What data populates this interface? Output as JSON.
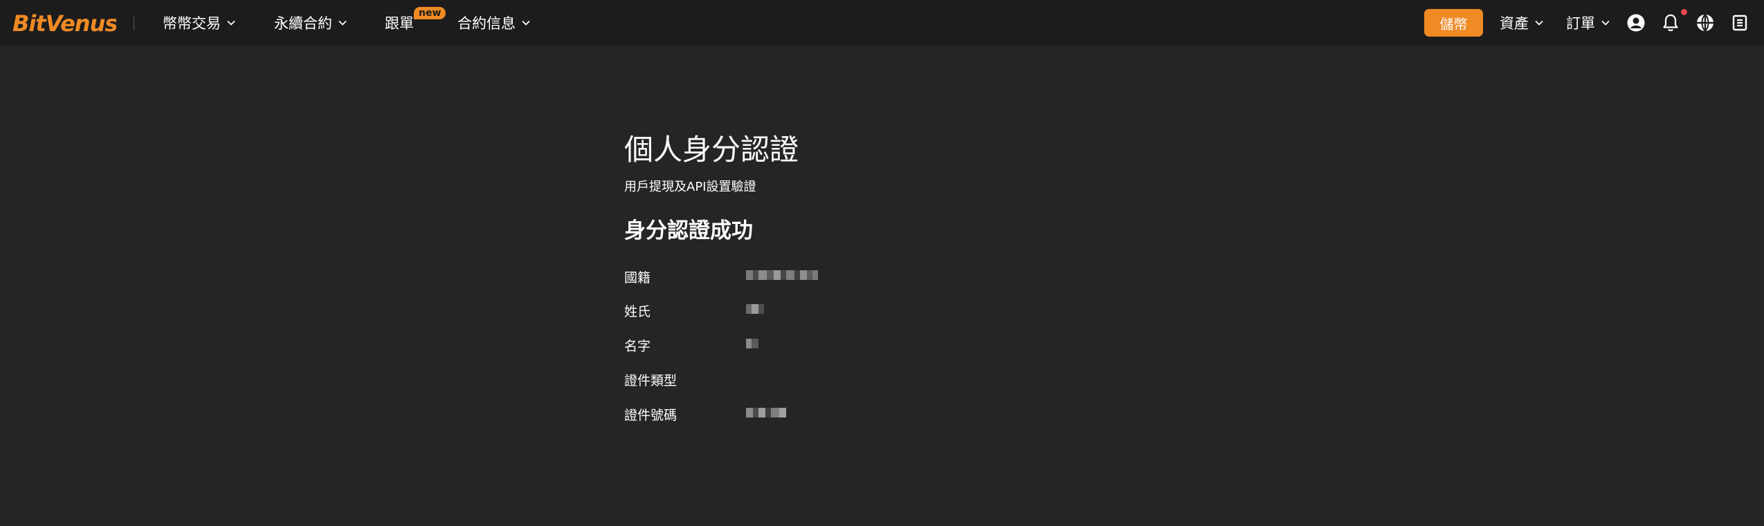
{
  "brand": {
    "logo_text": "BitVenus",
    "accent_color": "#f08a24"
  },
  "nav": {
    "items": [
      {
        "label": "幣幣交易",
        "icon": "chevron-down-icon"
      },
      {
        "label": "永續合約",
        "icon": "chevron-down-icon"
      },
      {
        "label": "跟單",
        "badge": "new"
      },
      {
        "label": "合約信息",
        "icon": "chevron-down-icon"
      }
    ],
    "deposit_label": "儲幣",
    "assets_label": "資產",
    "orders_label": "訂單",
    "right_icons": [
      "user-icon",
      "bell-icon",
      "globe-icon",
      "download-icon"
    ]
  },
  "page": {
    "title": "個人身分認證",
    "subtitle": "用戶提現及API設置驗證",
    "status_title": "身分認證成功",
    "fields": [
      {
        "label": "國籍",
        "value": ""
      },
      {
        "label": "姓氏",
        "value": ""
      },
      {
        "label": "名字",
        "value": ""
      },
      {
        "label": "證件類型",
        "value": ""
      },
      {
        "label": "證件號碼",
        "value": ""
      }
    ]
  }
}
